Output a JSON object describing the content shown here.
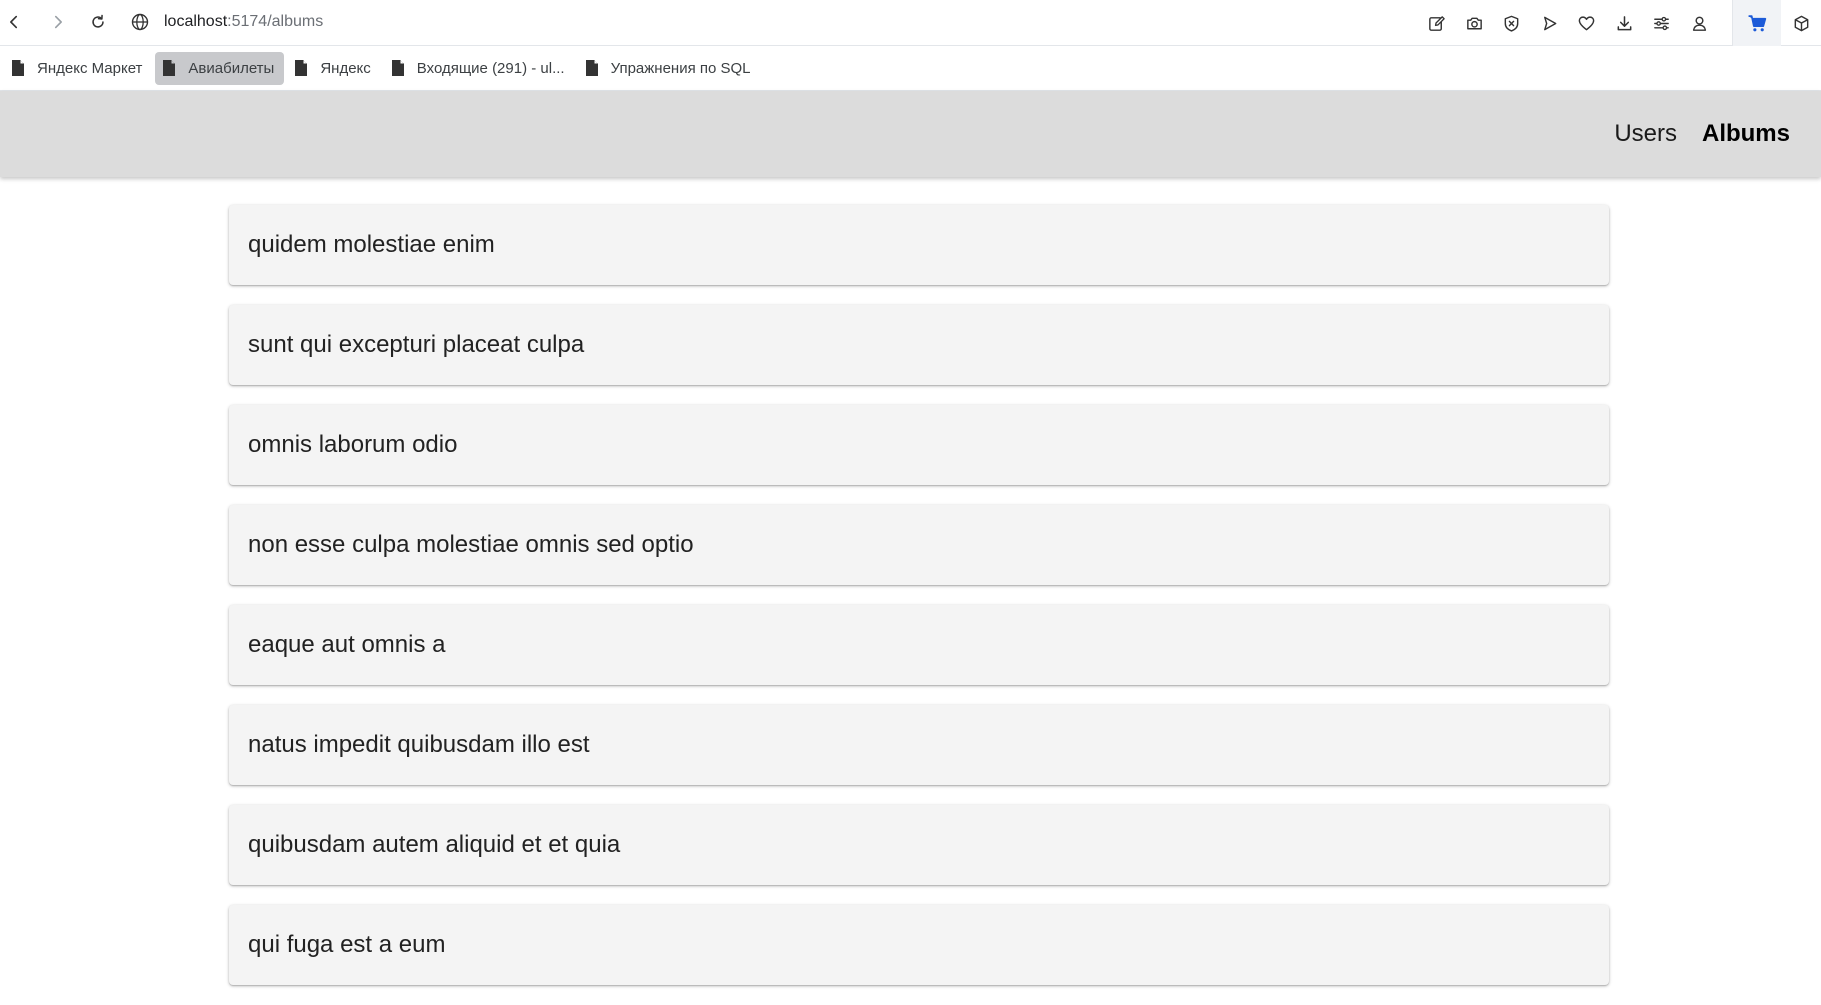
{
  "browser": {
    "address_host": "localhost",
    "address_path": ":5174/albums",
    "nav_icons": [
      "back-icon",
      "forward-icon",
      "reload-icon",
      "globe-icon"
    ],
    "toolbar_icons": [
      "edit-icon",
      "camera-icon",
      "shield-icon",
      "play-icon",
      "heart-icon",
      "download-icon",
      "sliders-icon",
      "profile-icon",
      "cart-icon",
      "box-icon"
    ]
  },
  "bookmarks": [
    {
      "label": "Яндекс Маркет",
      "icon": "page-icon"
    },
    {
      "label": "Авиабилеты",
      "icon": "page-icon",
      "active": true
    },
    {
      "label": "Яндекс",
      "icon": "page-icon"
    },
    {
      "label": "Входящие (291) - ul...",
      "icon": "page-icon"
    },
    {
      "label": "Упражнения по SQL",
      "icon": "page-icon"
    }
  ],
  "app_nav": {
    "users": "Users",
    "albums": "Albums",
    "active": "Albums"
  },
  "albums": [
    "quidem molestiae enim",
    "sunt qui excepturi placeat culpa",
    "omnis laborum odio",
    "non esse culpa molestiae omnis sed optio",
    "eaque aut omnis a",
    "natus impedit quibusdam illo est",
    "quibusdam autem aliquid et et quia",
    "qui fuga est a eum"
  ],
  "colors": {
    "header_bg": "#dcdcdc",
    "card_bg": "#f4f4f4",
    "cart_accent": "#1d5bd8"
  }
}
